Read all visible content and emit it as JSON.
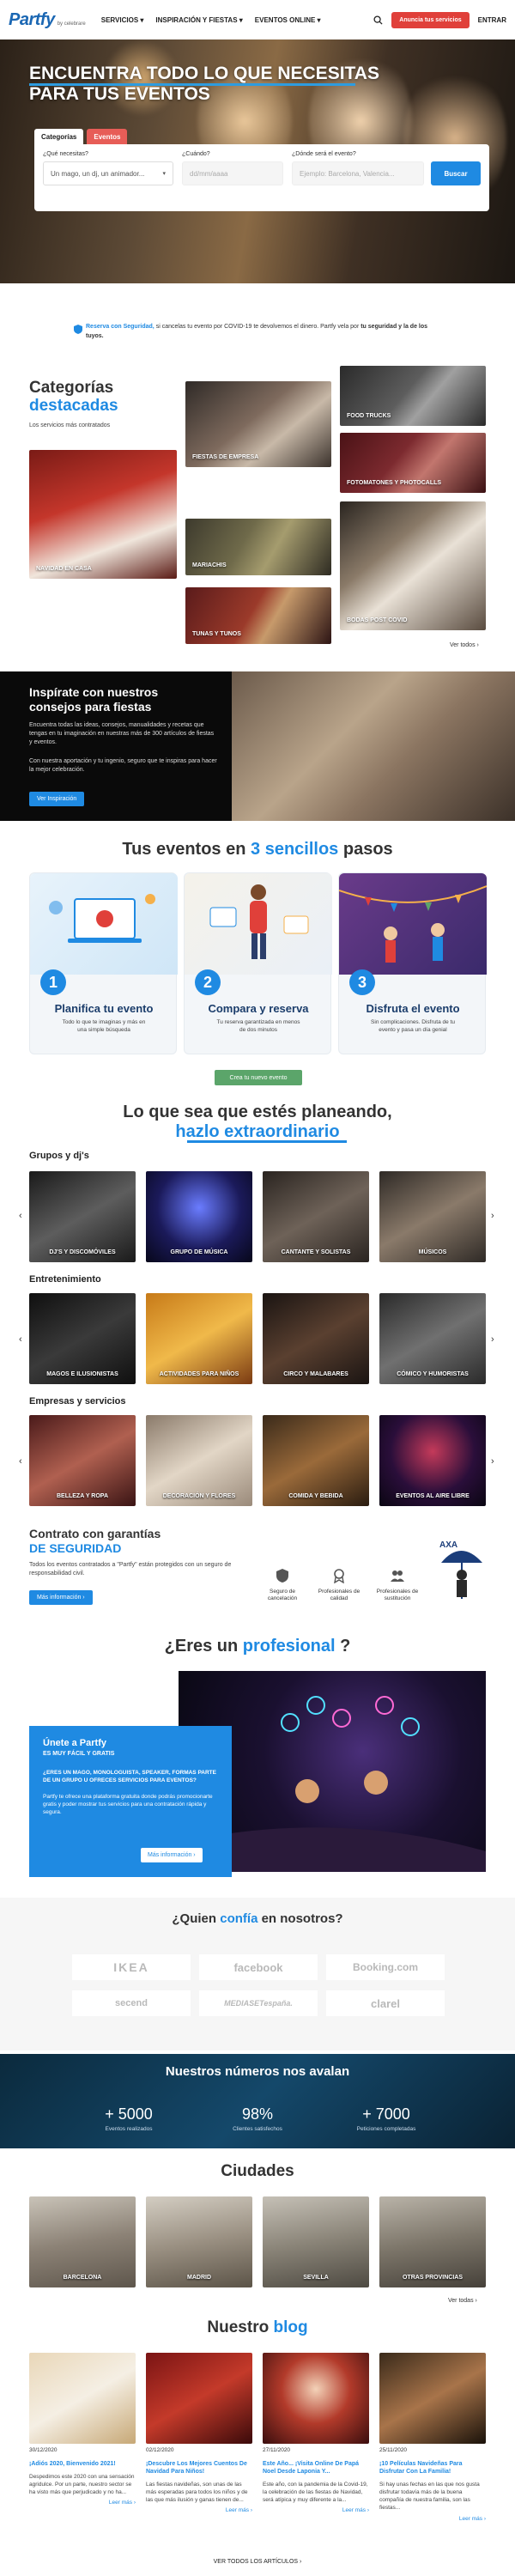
{
  "nav": {
    "logo": "Partfy",
    "logo_by": "by celebrare",
    "menu": [
      "SERVICIOS",
      "INSPIRACIÓN Y FIESTAS",
      "EVENTOS ONLINE"
    ],
    "cta": "Anuncia tus servicios",
    "login": "ENTRAR"
  },
  "hero": {
    "title_line1": "ENCUENTRA TODO LO QUE NECESITAS",
    "title_line2": "PARA TUS EVENTOS",
    "tabs": [
      "Categorías",
      "Eventos"
    ],
    "q_what": "¿Qué necesitas?",
    "q_what_value": "Un mago, un dj, un animador...",
    "q_when": "¿Cuándo?",
    "q_when_placeholder": "dd/mm/aaaa",
    "q_where": "¿Dónde será el evento?",
    "q_where_placeholder": "Ejemplo: Barcelona, Valencia...",
    "search_button": "Buscar"
  },
  "safe": {
    "link": "Reserva con Seguridad,",
    "text": " si cancelas tu evento por COVID-19 te devolvemos el dinero. Partfy vela por",
    "bold": " tu seguridad y la de los tuyos."
  },
  "categories": {
    "title1": "Categorías",
    "title2": "destacadas",
    "subtitle": "Los servicios más contratados",
    "tiles": [
      "NAVIDAD EN CASA",
      "FIESTAS DE EMPRESA",
      "MARIACHIS",
      "TUNAS Y TUNOS",
      "FOOD TRUCKS",
      "FOTOMATONES Y PHOTOCALLS",
      "BODAS POST COVID"
    ],
    "see_all": "Ver todos ›"
  },
  "inspiration": {
    "title": "Inspírate con nuestros consejos para fiestas",
    "p1": "Encuentra todas las ideas, consejos, manualidades y recetas que tengas en tu imaginación en nuestras más de 300 artículos de fiestas y eventos.",
    "p2": "Con nuestra aportación y tu ingenio, seguro que te inspiras para hacer la mejor celebración.",
    "button": "Ver Inspiración"
  },
  "steps": {
    "title_a": "Tus eventos en ",
    "title_b": "3 sencillos",
    "title_c": " pasos",
    "items": [
      {
        "num": "1",
        "title": "Planifica tu evento",
        "text": "Todo lo que te imaginas y más en una simple búsqueda"
      },
      {
        "num": "2",
        "title": "Compara y reserva",
        "text": "Tu reserva garantizada en menos de dos minutos"
      },
      {
        "num": "3",
        "title": "Disfruta el evento",
        "text": "Sin complicaciones. Disfruta de tu evento y pasa un día genial"
      }
    ],
    "button": "Crea tu nuevo evento"
  },
  "planning": {
    "title1": "Lo que sea que estés planeando,",
    "title2": "hazlo extraordinario",
    "groups": [
      {
        "label": "Grupos y dj's",
        "items": [
          "DJ'S Y DISCOMÓVILES",
          "GRUPO DE MÚSICA",
          "CANTANTE Y SOLISTAS",
          "MÚSICOS"
        ]
      },
      {
        "label": "Entretenimiento",
        "items": [
          "MAGOS E ILUSIONISTAS",
          "ACTIVIDADES PARA NIÑOS",
          "CIRCO Y MALABARES",
          "CÓMICO Y HUMORISTAS"
        ]
      },
      {
        "label": "Empresas y servicios",
        "items": [
          "BELLEZA Y ROPA",
          "DECORACIÓN Y FLORES",
          "COMIDA Y BEBIDA",
          "EVENTOS AL AIRE LIBRE"
        ]
      }
    ]
  },
  "guarantee": {
    "title1": "Contrato con garantías",
    "title2": "DE SEGURIDAD",
    "text": "Todos los eventos contratados a \"Partfy\" están protegidos con un seguro de responsabilidad civil.",
    "button": "Más información ›",
    "items": [
      "Seguro de cancelación",
      "Profesionales de calidad",
      "Profesionales de sustitución"
    ],
    "partner": "AXA"
  },
  "professional": {
    "title_a": "¿Eres un ",
    "title_b": "profesional",
    "title_c": " ?",
    "box_title": "Únete a Partfy",
    "box_sub": "ES MUY FÁCIL Y GRATIS",
    "box_p1": "¿ERES UN MAGO, MONOLOGUISTA, SPEAKER, FORMAS PARTE DE UN GRUPO U OFRECES SERVICIOS PARA EVENTOS?",
    "box_p2": "Partfy te ofrece una plataforma gratuita donde podrás promocionarte gratis y poder mostrar tus servicios para una contratación rápida y segura.",
    "button": "Más información ›"
  },
  "trust": {
    "title_a": "¿Quien ",
    "title_b": "confía",
    "title_c": " en nosotros?",
    "brands": [
      "IKEA",
      "facebook",
      "Booking.com",
      "secend",
      "MEDIASETespaña.",
      "clarel"
    ]
  },
  "numbers": {
    "title": "Nuestros números nos avalan",
    "items": [
      {
        "value": "+ 5000",
        "label": "Eventos realizados"
      },
      {
        "value": "98%",
        "label": "Clientes satisfechos"
      },
      {
        "value": "+ 7000",
        "label": "Peticiones completadas"
      }
    ]
  },
  "cities": {
    "title": "Ciudades",
    "items": [
      "BARCELONA",
      "MADRID",
      "SEVILLA",
      "OTRAS PROVINCIAS"
    ],
    "see_all": "Ver todas ›"
  },
  "blog": {
    "title_a": "Nuestro ",
    "title_b": "blog",
    "posts": [
      {
        "date": "30/12/2020",
        "title": "¡Adiós 2020, Bienvenido 2021!",
        "excerpt": "Despedimos este 2020 con una sensación agridulce. Por un parte, nuestro sector se ha visto más que perjudicado y no ha...",
        "more": "Leer más ›"
      },
      {
        "date": "02/12/2020",
        "title": "¡Descubre Los Mejores Cuentos De Navidad Para Niños!",
        "excerpt": "Las fiestas navideñas, son unas de las más esperadas para todos los niños y de las que más ilusión y ganas tienen de...",
        "more": "Leer más ›"
      },
      {
        "date": "27/11/2020",
        "title": "Este Año... ¡Visita Online De Papá Noel Desde Laponia Y...",
        "excerpt": "Este año, con la pandemia de la Covid-19, la celebración de las fiestas de Navidad, será atípica y muy diferente a la...",
        "more": "Leer más ›"
      },
      {
        "date": "25/11/2020",
        "title": "¡10 Películas Navideñas Para Disfrutar Con La Familia!",
        "excerpt": "Si hay unas fechas en las que nos gusta disfrutar todavía más de la buena compañía de nuestra familia, son las fiestas...",
        "more": "Leer más ›"
      }
    ],
    "all": "VER TODOS LOS ARTÍCULOS ›"
  }
}
